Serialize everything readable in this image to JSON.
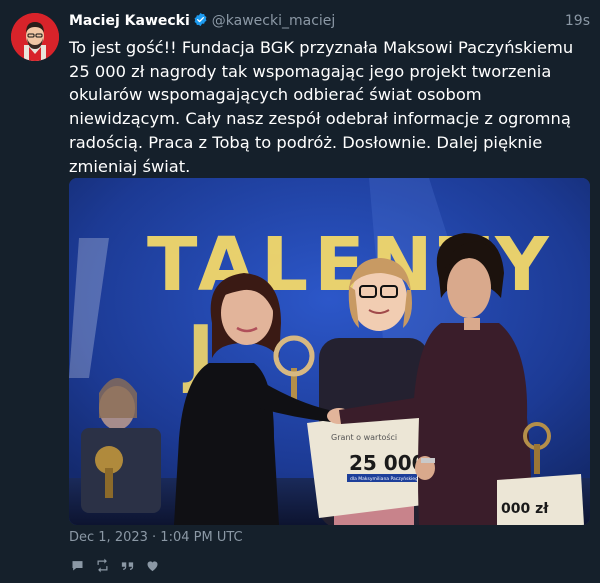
{
  "tweet": {
    "author_name": "Maciej Kawecki",
    "handle": "@kawecki_maciej",
    "relative_time": "19s",
    "text": "To jest gość!! Fundacja BGK przyznała Maksowi Paczyńskiemu\n25 000 zł nagrody tak wspomagając jego projekt tworzenia\nokularów wspomagających odbierać świat osobom\nniewidzącym. Cały nasz zespół odebrał informacje z ogromną\nradością. Praca z Tobą to podróż. Dosłownie. Dalej pięknie\nzmieniaj świat.",
    "date": "Dec 1, 2023 · 1:04 PM UTC"
  },
  "photo": {
    "sign_text": "TALENTY",
    "sign_text_2": "J",
    "cheque_caption": "Grant o wartości",
    "cheque_amount": "25 000",
    "cheque_name": "dla Maksymiliana Paczyńskiego",
    "cheque_right_amount": "000 zł"
  },
  "colors": {
    "background": "#15202b",
    "text_secondary": "#8b98a5",
    "verified": "#1d9bf0",
    "avatar_bg": "#d8232a"
  },
  "icons": [
    "verified-badge-icon",
    "reply-icon",
    "retweet-icon",
    "quote-icon",
    "like-icon"
  ]
}
